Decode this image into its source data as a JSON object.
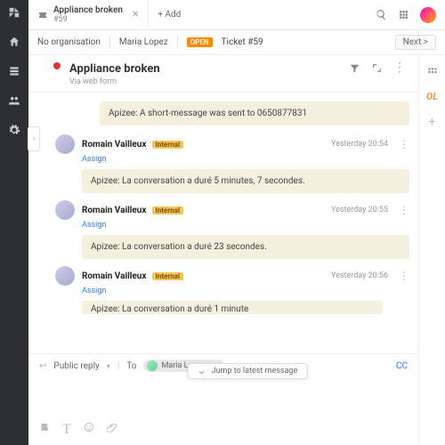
{
  "tab": {
    "title": "Appliance broken",
    "sub": "#59",
    "add": "+ Add"
  },
  "crumbs": {
    "org": "No organisation",
    "user": "Maria Lopez",
    "open": "OPEN",
    "ticket": "Ticket #59",
    "next": "Next >"
  },
  "ticket": {
    "title": "Appliance broken",
    "via": "Via web form"
  },
  "notes": {
    "n0": "Apizee: A short-message was sent to 0650877831"
  },
  "entries": [
    {
      "author": "Romain Vailleux",
      "tag": "Internal",
      "assign": "Assign",
      "time": "Yesterday 20:54",
      "body": "Apizee: La conversation a duré 5 minutes, 7 secondes."
    },
    {
      "author": "Romain Vailleux",
      "tag": "Internal",
      "assign": "Assign",
      "time": "Yesterday 20:55",
      "body": "Apizee: La conversation a duré 23 secondes."
    },
    {
      "author": "Romain Vailleux",
      "tag": "Internal",
      "assign": "Assign",
      "time": "Yesterday 20:56",
      "body": "Apizee: La conversation a duré 1 minute"
    }
  ],
  "jump": "Jump to latest message",
  "composer": {
    "mode": "Public reply",
    "to_label": "To",
    "recipient": "Maria Lopez",
    "cc": "CC"
  }
}
